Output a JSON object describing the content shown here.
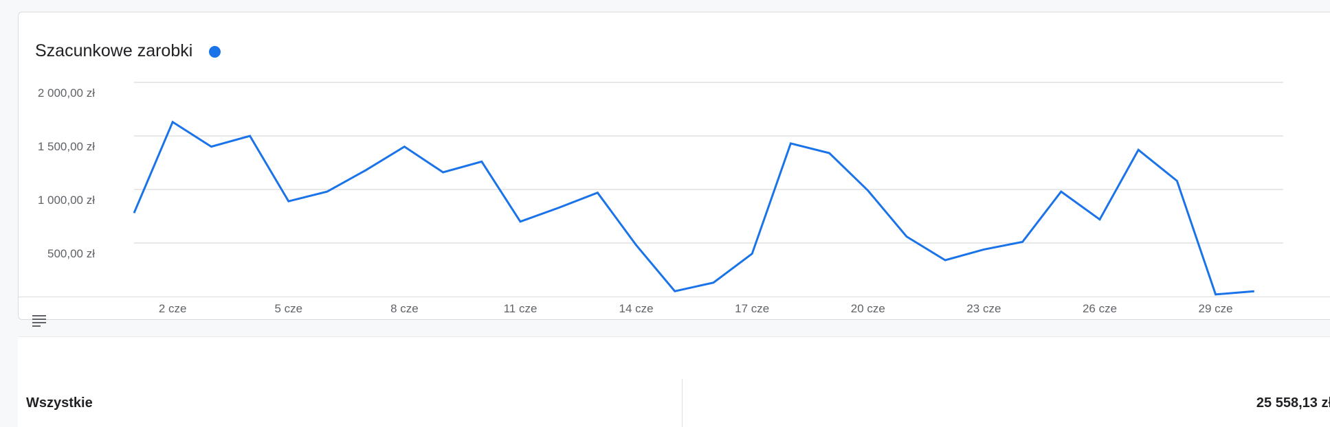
{
  "chart_card": {
    "title": "Szacunkowe zarobki",
    "legend_color": "#1a73e8"
  },
  "chart_data": {
    "type": "line",
    "title": "Szacunkowe zarobki",
    "x": [
      "1 cze",
      "2 cze",
      "3 cze",
      "4 cze",
      "5 cze",
      "6 cze",
      "7 cze",
      "8 cze",
      "9 cze",
      "10 cze",
      "11 cze",
      "12 cze",
      "13 cze",
      "14 cze",
      "15 cze",
      "16 cze",
      "17 cze",
      "18 cze",
      "19 cze",
      "20 cze",
      "21 cze",
      "22 cze",
      "23 cze",
      "24 cze",
      "25 cze",
      "26 cze",
      "27 cze",
      "28 cze",
      "29 cze",
      "30 cze",
      "1 lip"
    ],
    "x_tick_labels": [
      "2 cze",
      "5 cze",
      "8 cze",
      "11 cze",
      "14 cze",
      "17 cze",
      "20 cze",
      "23 cze",
      "26 cze",
      "29 cze"
    ],
    "series": [
      {
        "color": "#1a73e8",
        "values": [
          780,
          1630,
          1400,
          1500,
          890,
          980,
          1180,
          1400,
          1160,
          1260,
          700,
          830,
          970,
          480,
          50,
          130,
          400,
          1430,
          1340,
          990,
          560,
          340,
          440,
          510,
          980,
          720,
          1370,
          1080,
          20,
          50
        ]
      }
    ],
    "y_tick_labels": [
      "500,00 zł",
      "1 000,00 zł",
      "1 500,00 zł",
      "2 000,00 zł"
    ],
    "y_ticks": [
      500,
      1000,
      1500,
      2000
    ],
    "ylim": [
      0,
      2000
    ],
    "grid": true,
    "legend": "top-left"
  },
  "summary": {
    "label": "Wszystkie",
    "value": "25 558,13 zł"
  }
}
